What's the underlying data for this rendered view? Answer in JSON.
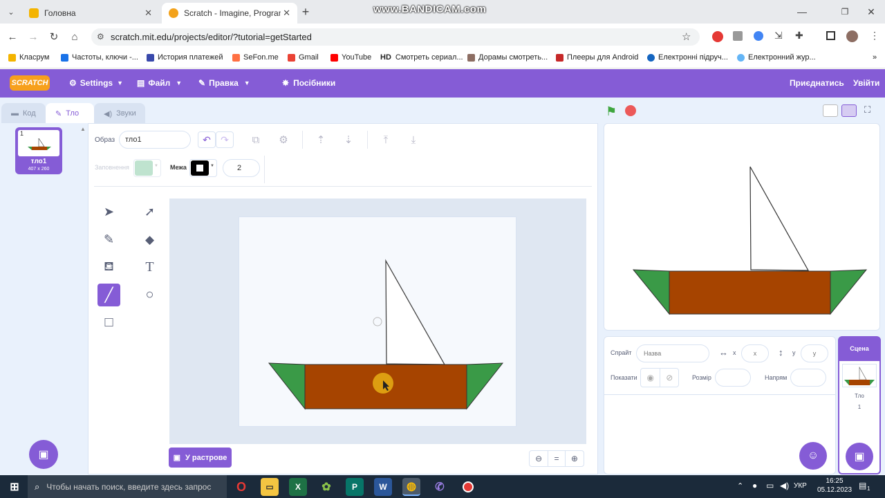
{
  "browser": {
    "tabs": [
      {
        "label": "Головна",
        "active": false
      },
      {
        "label": "Scratch - Imagine, Program, Sh",
        "active": true
      }
    ],
    "url": "scratch.mit.edu/projects/editor/?tutorial=getStarted",
    "recording_banner": "www.BANDICAM.com",
    "bookmarks": [
      "Класрум",
      "Частоты, ключи -...",
      "История платежей",
      "SeFon.me",
      "Gmail",
      "YouTube",
      "Смотреть сериал...",
      "Дорамы смотреть...",
      "Плееры для Android",
      "Електронні підруч...",
      "Електронний жур..."
    ],
    "bookmark_hd_prefix": "HD"
  },
  "menubar": {
    "logo": "SCRATCH",
    "settings": "Settings",
    "file": "Файл",
    "edit": "Правка",
    "tutorials": "Посібники",
    "join": "Приєднатись",
    "login": "Увійти"
  },
  "editor_tabs": {
    "code": "Код",
    "backdrop": "Тло",
    "sounds": "Звуки"
  },
  "backdrop_list": [
    {
      "index": "1",
      "name": "тло1",
      "size": "407 x 260"
    }
  ],
  "paint_editor": {
    "costume_label": "Образ",
    "costume_name": "тло1",
    "fill_label": "Заповнення",
    "outline_label": "Межа",
    "outline_width": "2",
    "bitmap_button": "У растрове",
    "zoom_reset": "="
  },
  "sprite_info": {
    "sprite_label": "Спрайт",
    "name_placeholder": "Назва",
    "x_label": "x",
    "x_placeholder": "x",
    "y_label": "y",
    "y_placeholder": "y",
    "show_label": "Показати",
    "size_label": "Розмір",
    "direction_label": "Напрям"
  },
  "scene": {
    "title": "Сцена",
    "backdrops_label": "Тло",
    "backdrops_count": "1"
  },
  "taskbar": {
    "search_placeholder": "Чтобы начать поиск, введите здесь запрос",
    "lang": "УКР",
    "time": "16:25",
    "date": "05.12.2023",
    "notifications": "1"
  },
  "colors": {
    "scratch_purple": "#855cd6",
    "hull_brown": "#a64400",
    "hull_green": "#3a9a47"
  }
}
